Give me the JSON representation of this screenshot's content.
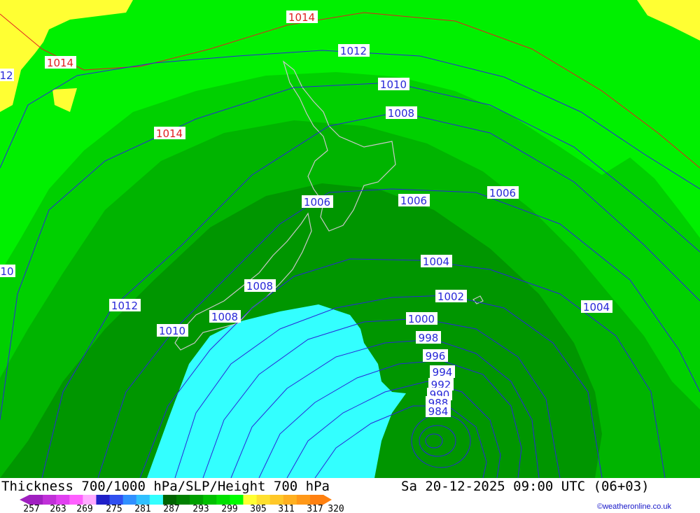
{
  "title": "Thickness 700/1000 hPa/SLP/Height 700 hPa",
  "datetime": "Sa 20-12-2025 09:00 UTC (06+03)",
  "credit": "©weatheronline.co.uk",
  "colors": {
    "isobar_blue": "#2828d8",
    "isobar_red": "#e02020",
    "thickness_299_305": "#00f000",
    "thickness_293_299": "#00d000",
    "thickness_287_293": "#00b400",
    "thickness_281_287": "#009600",
    "thickness_cold": "#33ffff",
    "warm_yellow": "#ffff33",
    "coast": "#c8c8c8"
  },
  "scale": {
    "ticks": [
      "257",
      "263",
      "269",
      "275",
      "281",
      "287",
      "293",
      "299",
      "305",
      "311",
      "317",
      "320"
    ],
    "colors": [
      "#a020c0",
      "#c030d8",
      "#e040f0",
      "#ff60ff",
      "#ffaaff",
      "#2020c8",
      "#3050f0",
      "#3090ff",
      "#30c0ff",
      "#33ffff",
      "#006400",
      "#008000",
      "#00a000",
      "#00c000",
      "#00e000",
      "#00ff00",
      "#ffff33",
      "#ffe030",
      "#ffc828",
      "#ffb020",
      "#ff9818",
      "#ff8010"
    ]
  },
  "isobar_labels": [
    {
      "text": "1014",
      "color": "red"
    },
    {
      "text": "1014",
      "color": "red"
    },
    {
      "text": "1014",
      "color": "red"
    },
    {
      "text": "1012",
      "color": "blue"
    },
    {
      "text": "12",
      "color": "blue"
    },
    {
      "text": "1010",
      "color": "blue"
    },
    {
      "text": "1008",
      "color": "blue"
    },
    {
      "text": "1006",
      "color": "blue"
    },
    {
      "text": "1006",
      "color": "blue"
    },
    {
      "text": "1006",
      "color": "blue"
    },
    {
      "text": "10",
      "color": "blue"
    },
    {
      "text": "1004",
      "color": "blue"
    },
    {
      "text": "1008",
      "color": "blue"
    },
    {
      "text": "1002",
      "color": "blue"
    },
    {
      "text": "1004",
      "color": "blue"
    },
    {
      "text": "1012",
      "color": "blue"
    },
    {
      "text": "1008",
      "color": "blue"
    },
    {
      "text": "1000",
      "color": "blue"
    },
    {
      "text": "1010",
      "color": "blue"
    },
    {
      "text": "998",
      "color": "blue"
    },
    {
      "text": "996",
      "color": "blue"
    },
    {
      "text": "994",
      "color": "blue"
    },
    {
      "text": "992",
      "color": "blue"
    },
    {
      "text": "990",
      "color": "blue"
    },
    {
      "text": "988",
      "color": "blue"
    },
    {
      "text": "984",
      "color": "blue"
    }
  ]
}
